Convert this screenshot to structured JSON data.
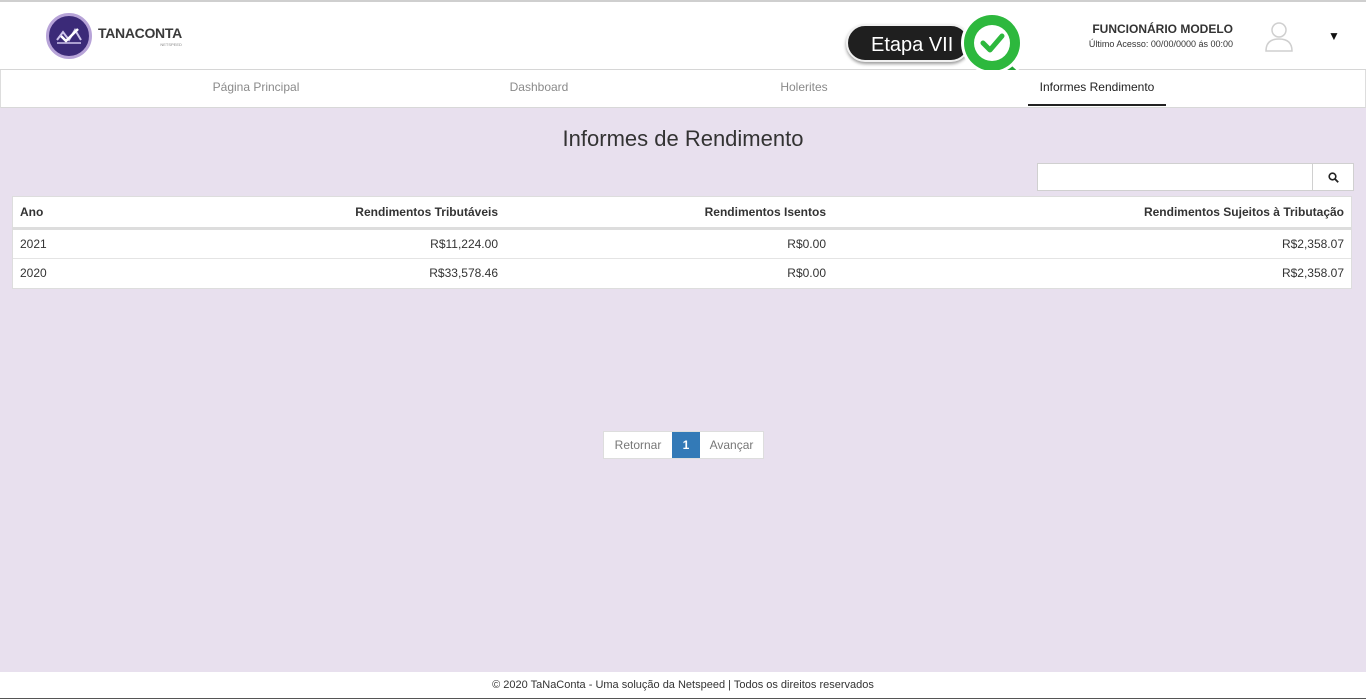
{
  "header": {
    "logo_name": "TANACONTA",
    "logo_sub": "NETSPEED",
    "etapa_label": "Etapa VII",
    "user_name": "FUNCIONÁRIO MODELO",
    "last_access": "Último Acesso: 00/00/0000 ás 00:00",
    "caret": "▼"
  },
  "nav": {
    "items": [
      {
        "label": "Página Principal"
      },
      {
        "label": "Dashboard"
      },
      {
        "label": "Holerites"
      },
      {
        "label": "Informes Rendimento"
      }
    ]
  },
  "main": {
    "title": "Informes de Rendimento",
    "search": {
      "value": "",
      "placeholder": ""
    },
    "table": {
      "headers": [
        "Ano",
        "Rendimentos Tributáveis",
        "Rendimentos Isentos",
        "Rendimentos Sujeitos à Tributação"
      ],
      "rows": [
        [
          "2021",
          "R$11,224.00",
          "R$0.00",
          "R$2,358.07"
        ],
        [
          "2020",
          "R$33,578.46",
          "R$0.00",
          "R$2,358.07"
        ]
      ]
    },
    "pagination": {
      "prev": "Retornar",
      "current": "1",
      "next": "Avançar"
    }
  },
  "footer": {
    "text": "© 2020 TaNaConta - Uma solução da Netspeed | Todos os direitos reservados"
  },
  "colors": {
    "background": "#e8e0ee",
    "accent": "#337ab7",
    "badge_green": "#2db83d",
    "logo_purple": "#3b2a78"
  },
  "icons": [
    "search-icon",
    "user-avatar-icon",
    "check-icon",
    "logo-check-icon"
  ]
}
